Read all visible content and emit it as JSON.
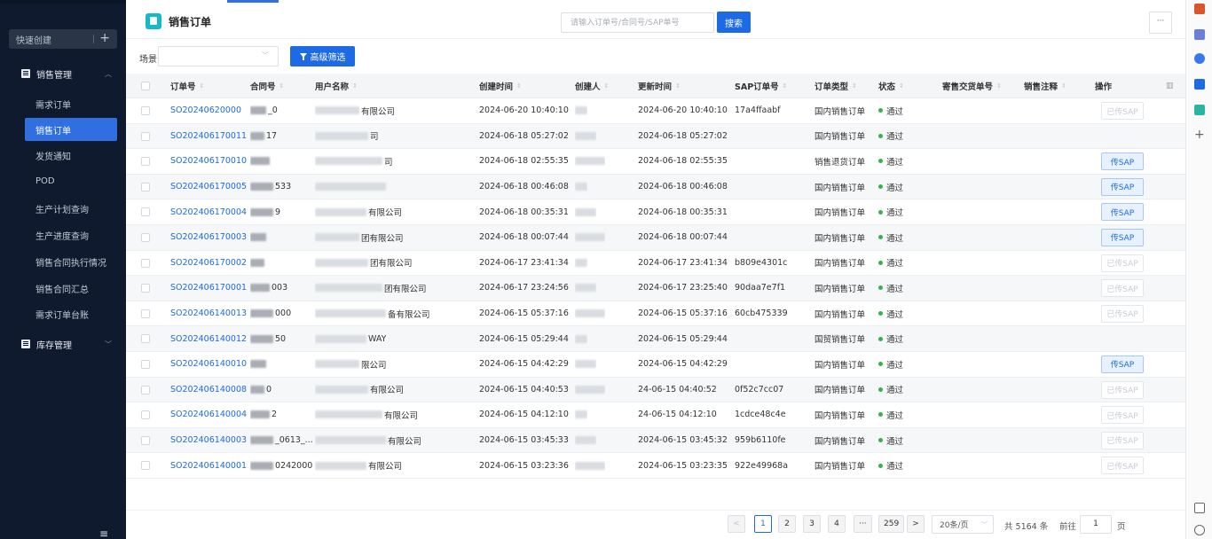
{
  "sidebar": {
    "quick_create": "快速创建",
    "quick_create_plus": "+",
    "groups": [
      {
        "label": "销售管理"
      },
      {
        "label": "库存管理"
      }
    ],
    "items": [
      {
        "label": "需求订单"
      },
      {
        "label": "销售订单"
      },
      {
        "label": "发货通知"
      },
      {
        "label": "POD"
      },
      {
        "label": "生产计划查询"
      },
      {
        "label": "生产进度查询"
      },
      {
        "label": "销售合同执行情况"
      },
      {
        "label": "销售合同汇总"
      },
      {
        "label": "需求订单台账"
      }
    ],
    "collapse_glyph": "≡"
  },
  "header": {
    "title": "销售订单",
    "search_placeholder": "请输入订单号/合同号/SAP单号",
    "search_button": "搜索",
    "more_button": "···"
  },
  "filters": {
    "scene_label": "场景:",
    "advanced_button": "高级筛选"
  },
  "table": {
    "columns": [
      "订单号",
      "合同号",
      "用户名称",
      "创建时间",
      "创建人",
      "更新时间",
      "SAP订单号",
      "订单类型",
      "状态",
      "寄售交货单号",
      "销售注释",
      "操作"
    ],
    "rows": [
      {
        "order": "SO20240620000",
        "contract": "_0",
        "customer": "有限公司",
        "created": "2024-06-20 10:40:10",
        "updated": "2024-06-20 10:40:10",
        "sap": "17a4ffaabf",
        "type": "国内销售订单",
        "status": "通过",
        "action": "已传SAP",
        "action_on": false
      },
      {
        "order": "SO202406170011",
        "contract": "17",
        "customer": "司",
        "created": "2024-06-18 05:27:02",
        "updated": "2024-06-18 05:27:02",
        "sap": "",
        "type": "国内销售订单",
        "status": "通过",
        "action": "",
        "action_on": false
      },
      {
        "order": "SO202406170010",
        "contract": "",
        "customer": "司",
        "created": "2024-06-18 02:55:35",
        "updated": "2024-06-18 02:55:35",
        "sap": "",
        "type": "销售退货订单",
        "status": "通过",
        "action": "传SAP",
        "action_on": true
      },
      {
        "order": "SO202406170005",
        "contract": "533",
        "customer": "",
        "created": "2024-06-18 00:46:08",
        "updated": "2024-06-18 00:46:08",
        "sap": "",
        "type": "国内销售订单",
        "status": "通过",
        "action": "传SAP",
        "action_on": true
      },
      {
        "order": "SO202406170004",
        "contract": "9",
        "customer": "有限公司",
        "created": "2024-06-18 00:35:31",
        "updated": "2024-06-18 00:35:31",
        "sap": "",
        "type": "国内销售订单",
        "status": "通过",
        "action": "传SAP",
        "action_on": true
      },
      {
        "order": "SO202406170003",
        "contract": "",
        "customer": "团有限公司",
        "created": "2024-06-18 00:07:44",
        "updated": "2024-06-18 00:07:44",
        "sap": "",
        "type": "国内销售订单",
        "status": "通过",
        "action": "传SAP",
        "action_on": true
      },
      {
        "order": "SO202406170002",
        "contract": "",
        "customer": "团有限公司",
        "created": "2024-06-17 23:41:34",
        "updated": "2024-06-17 23:41:34",
        "sap": "b809e4301c",
        "type": "国内销售订单",
        "status": "通过",
        "action": "已传SAP",
        "action_on": false
      },
      {
        "order": "SO202406170001",
        "contract": "003",
        "customer": "团有限公司",
        "created": "2024-06-17 23:24:56",
        "updated": "2024-06-17 23:25:40",
        "sap": "90daa7e7f1",
        "type": "国内销售订单",
        "status": "通过",
        "action": "已传SAP",
        "action_on": false
      },
      {
        "order": "SO202406140013",
        "contract": "000",
        "customer": "备有限公司",
        "created": "2024-06-15 05:37:16",
        "updated": "2024-06-15 05:37:16",
        "sap": "60cb475339",
        "type": "国内销售订单",
        "status": "通过",
        "action": "已传SAP",
        "action_on": false
      },
      {
        "order": "SO202406140012",
        "contract": "50",
        "customer": "WAY",
        "created": "2024-06-15 05:29:44",
        "updated": "2024-06-15 05:29:44",
        "sap": "",
        "type": "国贸销售订单",
        "status": "通过",
        "action": "",
        "action_on": false
      },
      {
        "order": "SO202406140010",
        "contract": "",
        "customer": "限公司",
        "created": "2024-06-15 04:42:29",
        "updated": "2024-06-15 04:42:29",
        "sap": "",
        "type": "国内销售订单",
        "status": "通过",
        "action": "传SAP",
        "action_on": true
      },
      {
        "order": "SO202406140008",
        "contract": "0",
        "customer": "有限公司",
        "created": "2024-06-15 04:40:53",
        "updated": "24-06-15 04:40:52",
        "sap": "0f52c7cc07",
        "type": "国内销售订单",
        "status": "通过",
        "action": "已传SAP",
        "action_on": false
      },
      {
        "order": "SO202406140004",
        "contract": "2",
        "customer": "有限公司",
        "created": "2024-06-15 04:12:10",
        "updated": "24-06-15 04:12:10",
        "sap": "1cdce48c4e",
        "type": "国内销售订单",
        "status": "通过",
        "action": "已传SAP",
        "action_on": false
      },
      {
        "order": "SO202406140003",
        "contract": "_0613_...",
        "customer": "有限公司",
        "created": "2024-06-15 03:45:33",
        "updated": "2024-06-15 03:45:32",
        "sap": "959b6110fe",
        "type": "国内销售订单",
        "status": "通过",
        "action": "已传SAP",
        "action_on": false
      },
      {
        "order": "SO202406140001",
        "contract": "0242000",
        "customer": "有限公司",
        "created": "2024-06-15 03:23:36",
        "updated": "2024-06-15 03:23:35",
        "sap": "922e49968a",
        "type": "国内销售订单",
        "status": "通过",
        "action": "已传SAP",
        "action_on": false
      }
    ]
  },
  "pagination": {
    "prev": "<",
    "pages": [
      "1",
      "2",
      "3",
      "4",
      "···",
      "259"
    ],
    "next": ">",
    "page_size": "20条/页",
    "total": "共 5164 条",
    "goto_label": "前往",
    "goto_value": "1",
    "page_suffix": "页"
  },
  "colors": {
    "accent": "#1d6ae5",
    "sidebar_bg": "#0f1a2e",
    "status_ok": "#35b24a"
  }
}
